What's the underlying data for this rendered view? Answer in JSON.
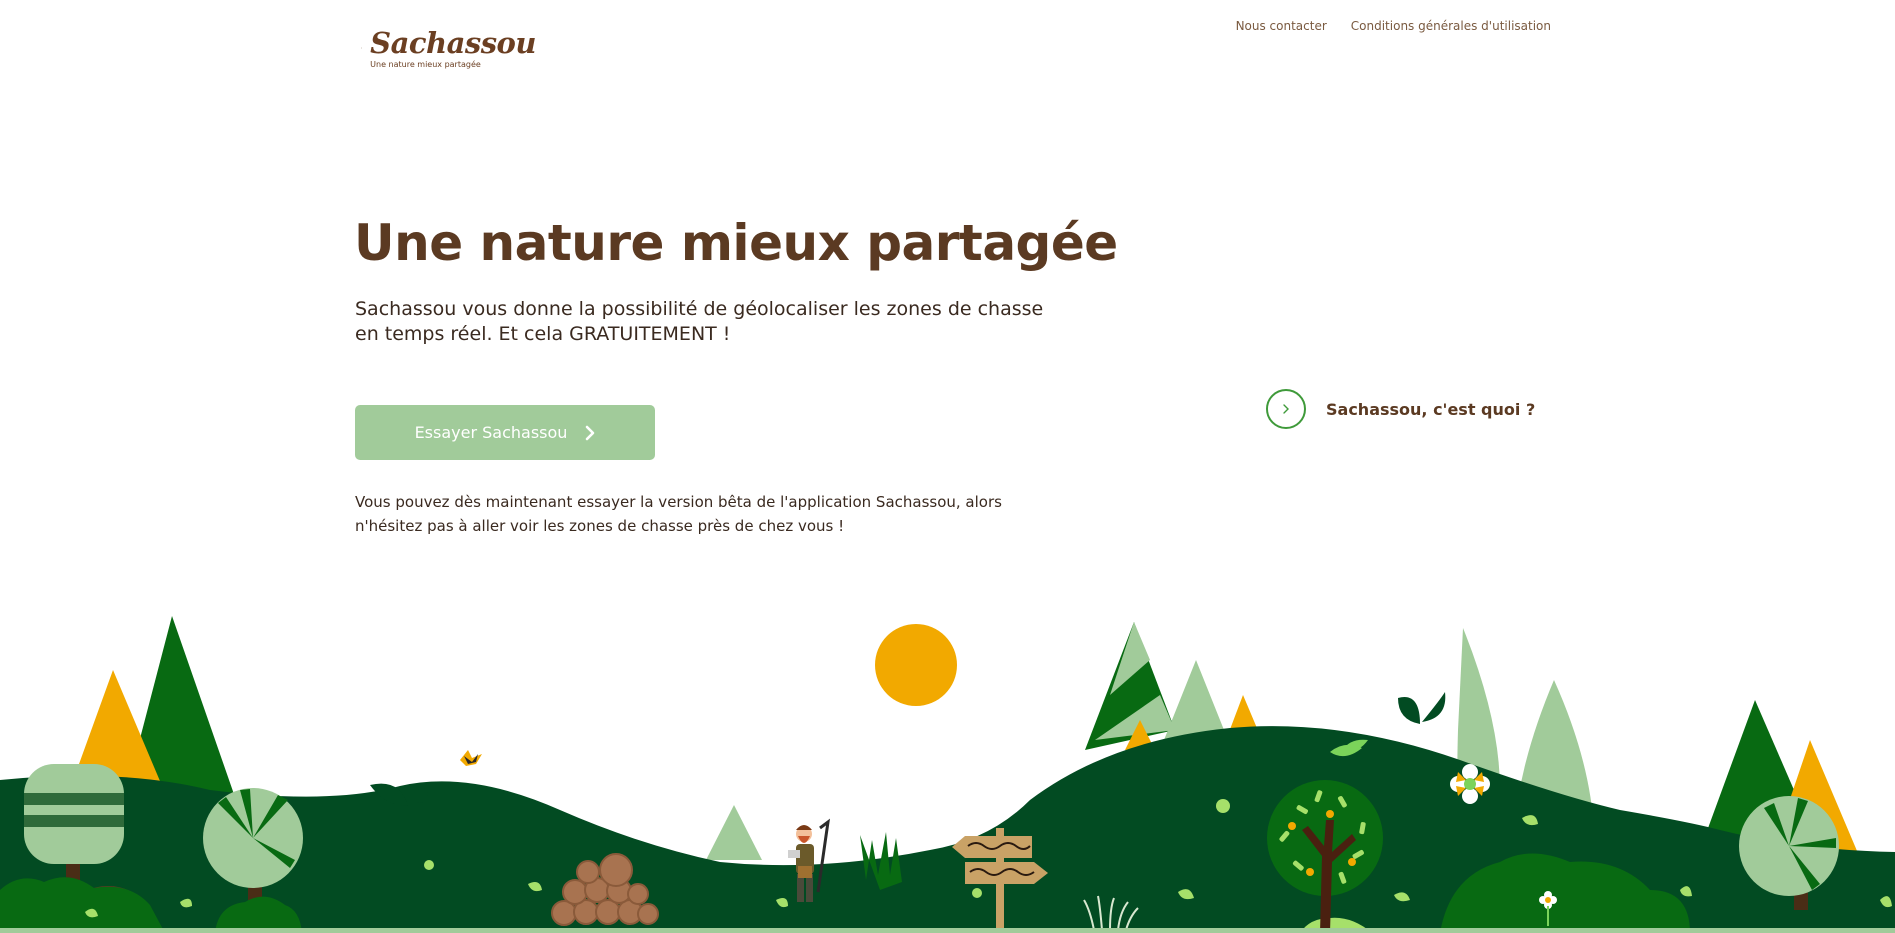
{
  "header": {
    "logo": {
      "name": "Sachassou",
      "tagline": "Une nature mieux partagée"
    },
    "nav": [
      {
        "label": "Nous contacter"
      },
      {
        "label": "Conditions générales d'utilisation"
      }
    ]
  },
  "hero": {
    "title": "Une nature mieux partagée",
    "lead": "Sachassou vous donne la possibilité de géolocaliser les zones de chasse en temps réel. Et cela GRATUITEMENT !",
    "cta_label": "Essayer Sachassou",
    "note": "Vous pouvez dès maintenant essayer la version bêta de l'application Sachassou, alors n'hésitez pas à aller voir les zones de chasse près de chez vous !"
  },
  "what_link": {
    "label": "Sachassou, c'est quoi ?",
    "icon": "chevron-right-icon"
  },
  "illustration": {
    "description_icons": [
      "sun",
      "trees",
      "hunter",
      "signpost",
      "boar",
      "bird",
      "log-pile",
      "flower"
    ]
  },
  "colors": {
    "brand_brown": "#5b3a22",
    "cta_green": "#a1cb9a",
    "dark_green": "#024b22",
    "tree_green": "#086a12",
    "light_green": "#a1cb9a",
    "sun_orange": "#f2a900"
  }
}
